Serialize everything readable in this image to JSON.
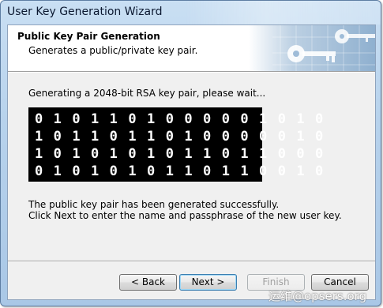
{
  "window": {
    "title": "User Key Generation Wizard"
  },
  "header": {
    "title": "Public Key Pair Generation",
    "subtitle": "Generates a public/private key pair."
  },
  "main": {
    "status": "Generating a 2048-bit RSA key pair, please wait...",
    "binary_rows": [
      "0101101000001010",
      "1011011010000010",
      "1010101011011000",
      "0101010110110010"
    ],
    "success_line1": "The public key pair has been generated successfully.",
    "success_line2": "Click Next to enter the name and passphrase of the new user key."
  },
  "buttons": {
    "back": "< Back",
    "next": "Next >",
    "finish": "Finish",
    "cancel": "Cancel"
  },
  "watermark": "运维@opsers.org",
  "colors": {
    "titlebar": "#b7d2ec",
    "client_bg": "#f0f0f0",
    "binary_bg": "#000000",
    "binary_fg": "#ffffff"
  }
}
